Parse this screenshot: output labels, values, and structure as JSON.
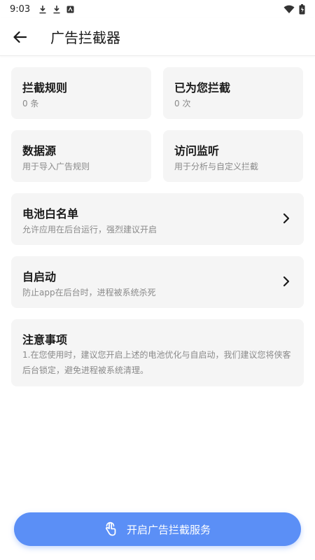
{
  "status_bar": {
    "time": "9:03",
    "icons": [
      "download-icon",
      "download-icon",
      "app-notification-icon",
      "wifi-icon",
      "battery-icon"
    ]
  },
  "app_bar": {
    "title": "广告拦截器"
  },
  "cards": {
    "rules": {
      "title": "拦截规则",
      "value": "0 条"
    },
    "blocked": {
      "title": "已为您拦截",
      "value": "0 次"
    },
    "data_source": {
      "title": "数据源",
      "subtitle": "用于导入广告规则"
    },
    "monitor": {
      "title": "访问监听",
      "subtitle": "用于分析与自定义拦截"
    },
    "battery_whitelist": {
      "title": "电池白名单",
      "subtitle": "允许应用在后台运行，强烈建议开启"
    },
    "autostart": {
      "title": "自启动",
      "subtitle": "防止app在后台时，进程被系统杀死"
    }
  },
  "notice": {
    "title": "注意事项",
    "body": "1.在您使用时，建议您开启上述的电池优化与自启动，我们建议您将侠客后台锁定，避免进程被系统清理。"
  },
  "primary_button": {
    "label": "开启广告拦截服务"
  },
  "colors": {
    "accent": "#5b8ff6",
    "card_bg": "#f5f5f5",
    "secondary_text": "#8a8a8a"
  }
}
